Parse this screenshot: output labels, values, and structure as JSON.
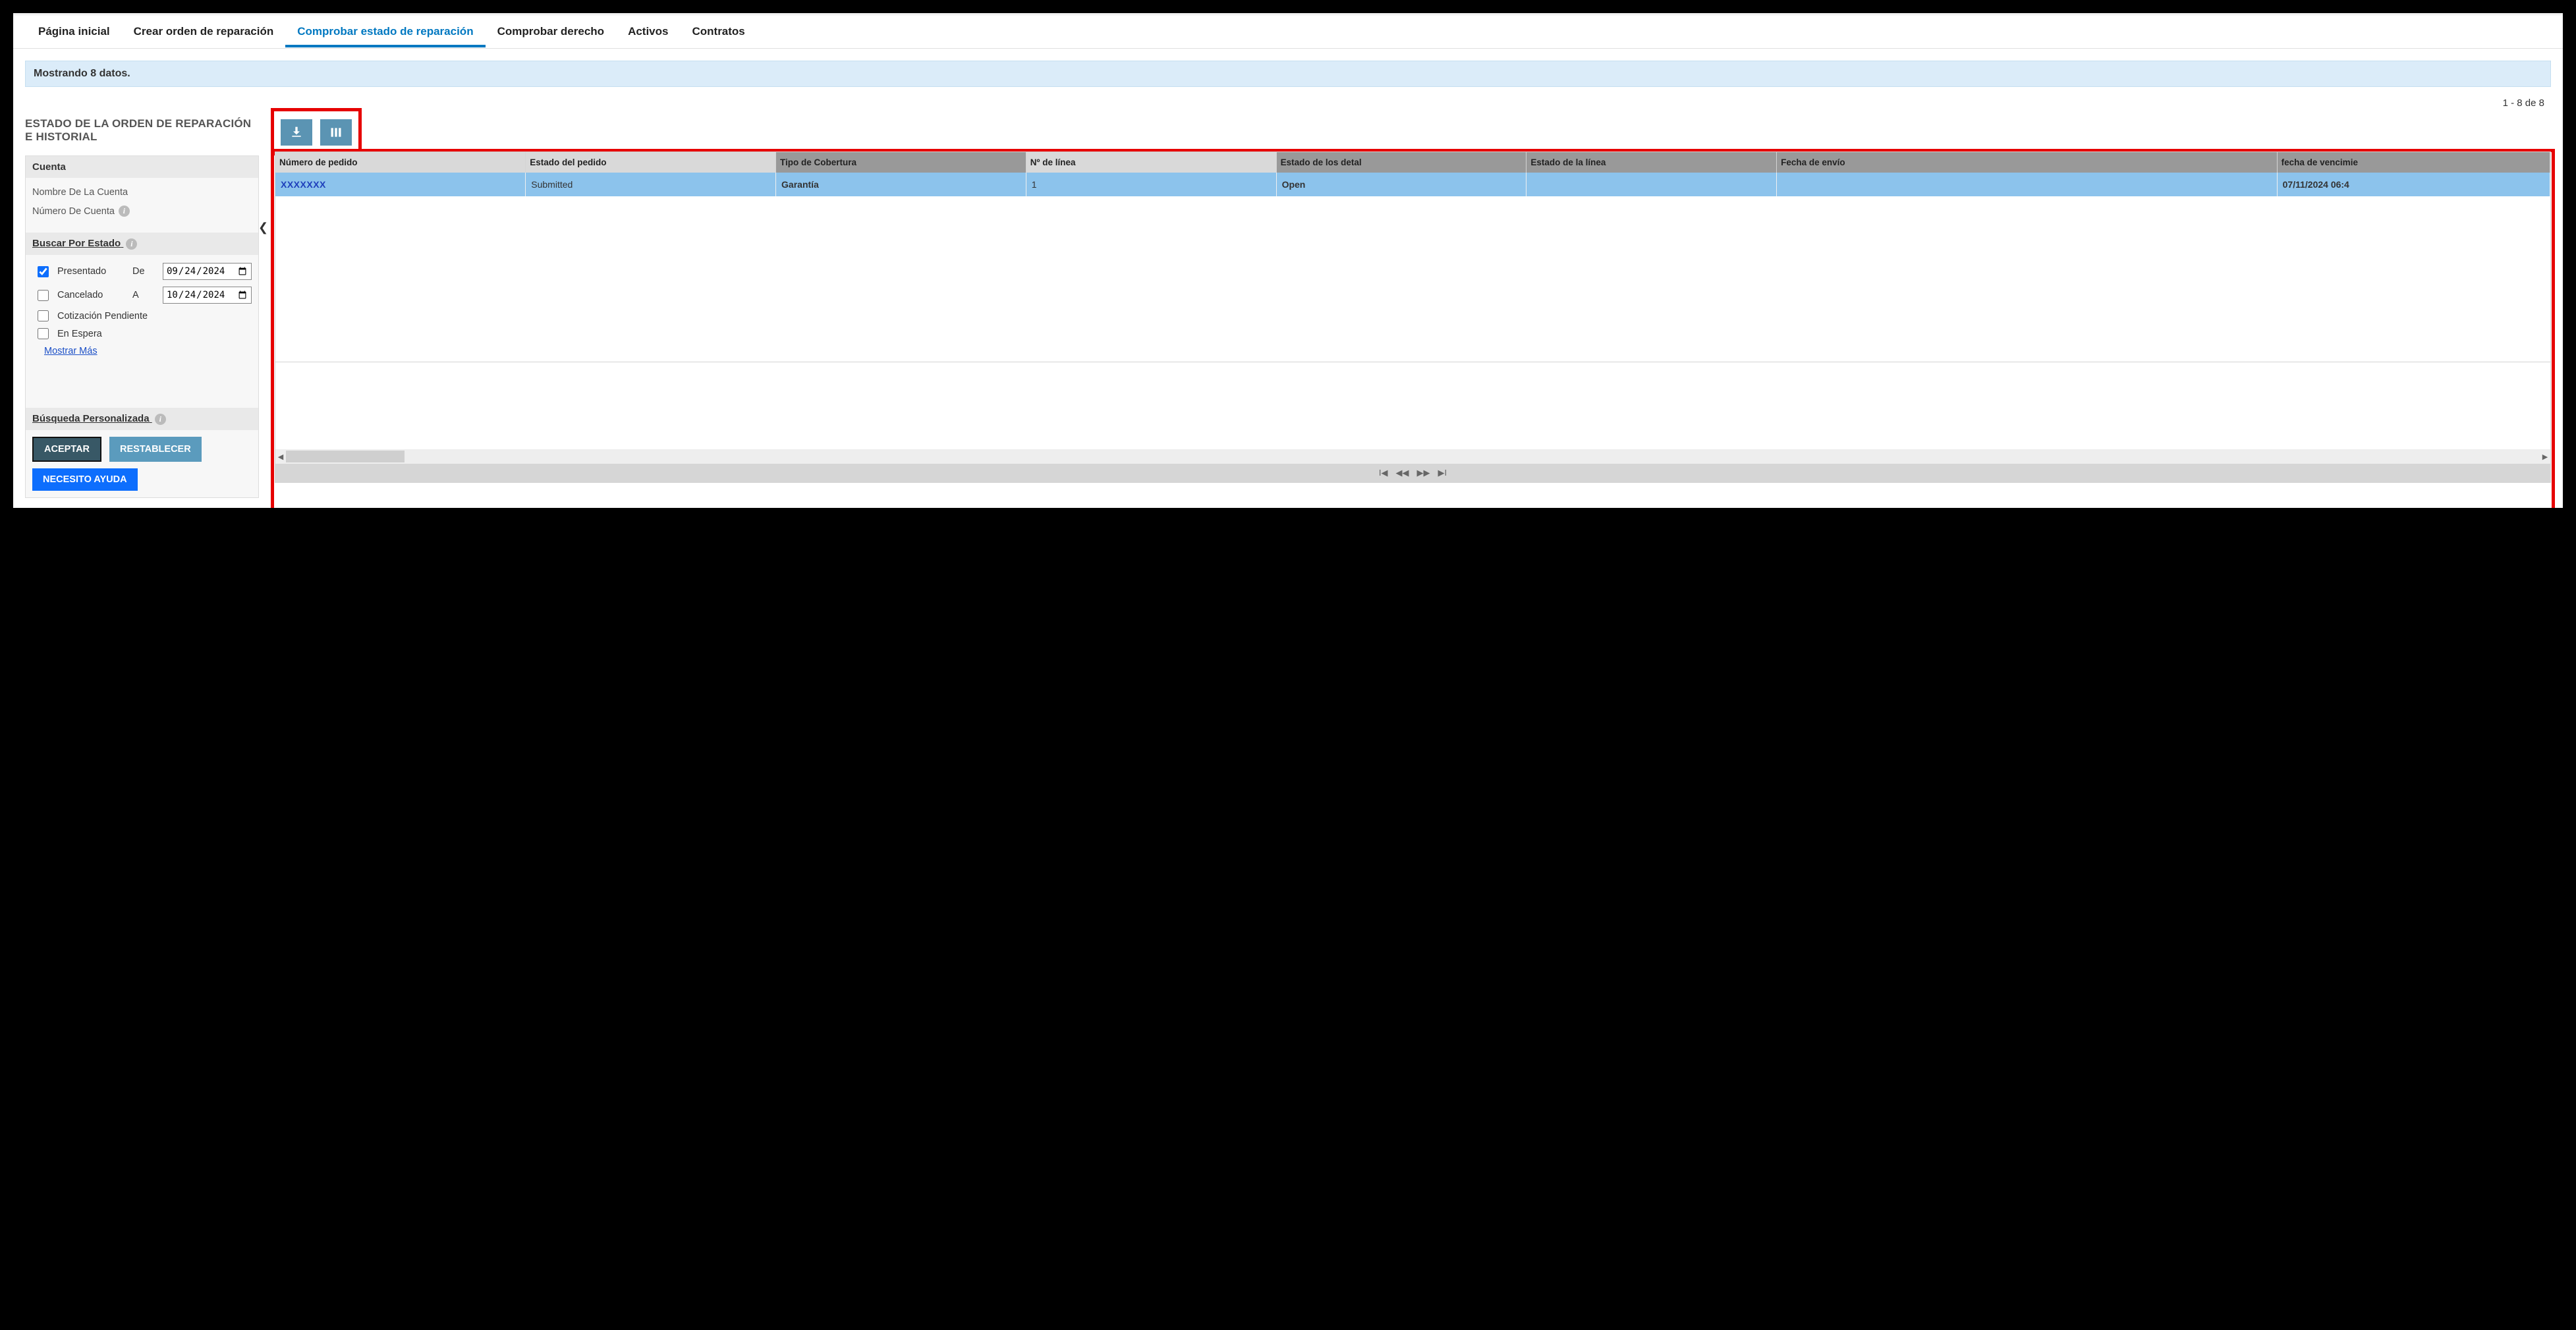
{
  "nav": {
    "home": "Página inicial",
    "create": "Crear orden de reparación",
    "check_status": "Comprobar estado de reparación",
    "check_entitlement": "Comprobar derecho",
    "assets": "Activos",
    "contracts": "Contratos"
  },
  "alert": "Mostrando 8 datos.",
  "pager": "1 - 8 de 8",
  "page_title": "ESTADO DE LA ORDEN DE REPARACIÓN E HISTORIAL",
  "sidebar": {
    "account_hdr": "Cuenta",
    "account_name_label": "Nombre De La Cuenta",
    "account_number_label": "Número De Cuenta",
    "search_status_hdr": "Buscar Por Estado",
    "status": {
      "submitted": "Presentado",
      "cancelled": "Cancelado",
      "quote_pending": "Cotización Pendiente",
      "on_hold": "En Espera"
    },
    "from_label": "De",
    "to_label": "A",
    "from_value": "2024-09-24",
    "to_value": "2024-10-24",
    "show_more": "Mostrar Más",
    "custom_search_hdr": "Búsqueda Personalizada",
    "accept": "ACEPTAR",
    "reset": "RESTABLECER",
    "help": "NECESITO AYUDA"
  },
  "table": {
    "headers": {
      "order_no": "Número de pedido",
      "order_status": "Estado del pedido",
      "coverage": "Tipo de Cobertura",
      "line_no": "Nº de línea",
      "detail_status": "Estado de los detal",
      "line_status": "Estado de la línea",
      "ship_date": "Fecha de envío",
      "due_date": "fecha de vencimie"
    },
    "rows": [
      {
        "order_no": "XXXXXXX",
        "order_status": "Submitted",
        "coverage": "Garantía",
        "line_no": "1",
        "detail_status": "Open",
        "line_status": "",
        "ship_date": "",
        "due_date": "07/11/2024 06:4"
      }
    ]
  }
}
